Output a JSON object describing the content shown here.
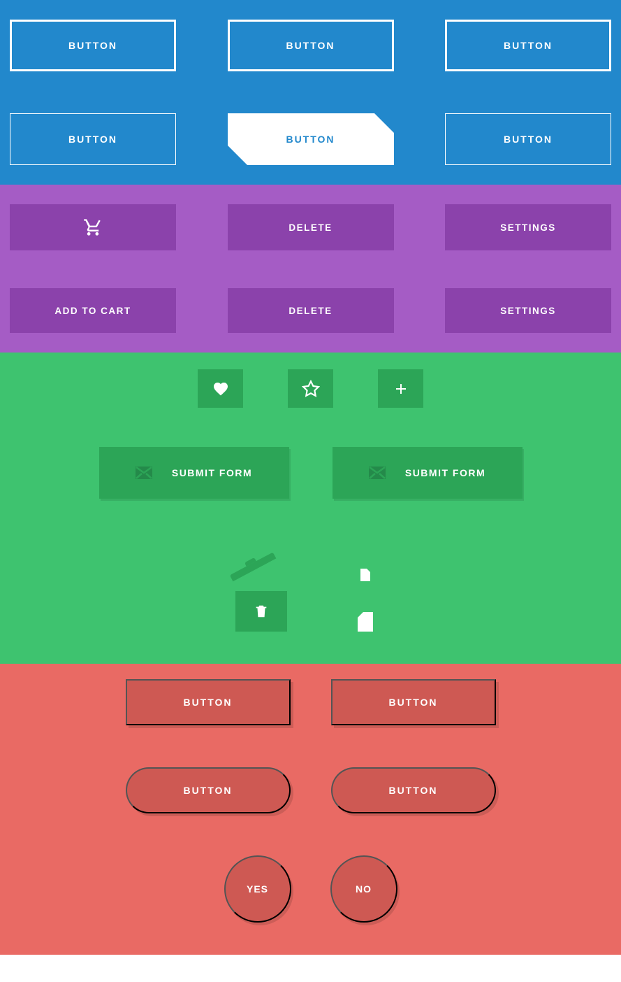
{
  "blue": {
    "row1": [
      "BUTTON",
      "BUTTON",
      "BUTTON"
    ],
    "row2": [
      "BUTTON",
      "BUTTON",
      "BUTTON"
    ]
  },
  "purple": {
    "delete": "DELETE",
    "settings": "SETTINGS",
    "add_to_cart": "ADD TO CART",
    "delete2": "DELETE",
    "settings2": "SETTINGS"
  },
  "green": {
    "submit1": "SUBMIT FORM",
    "submit2": "SUBMIT FORM"
  },
  "red": {
    "b1": "BUTTON",
    "b2": "BUTTON",
    "b3": "BUTTON",
    "b4": "BUTTON",
    "yes": "YES",
    "no": "NO"
  },
  "colors": {
    "blue": "#2288cc",
    "purple": "#a55cc5",
    "purple_dark": "#8b42ab",
    "green": "#3ec36f",
    "green_dark": "#2ca557",
    "red": "#e96a64",
    "red_dark": "#ce5953"
  }
}
